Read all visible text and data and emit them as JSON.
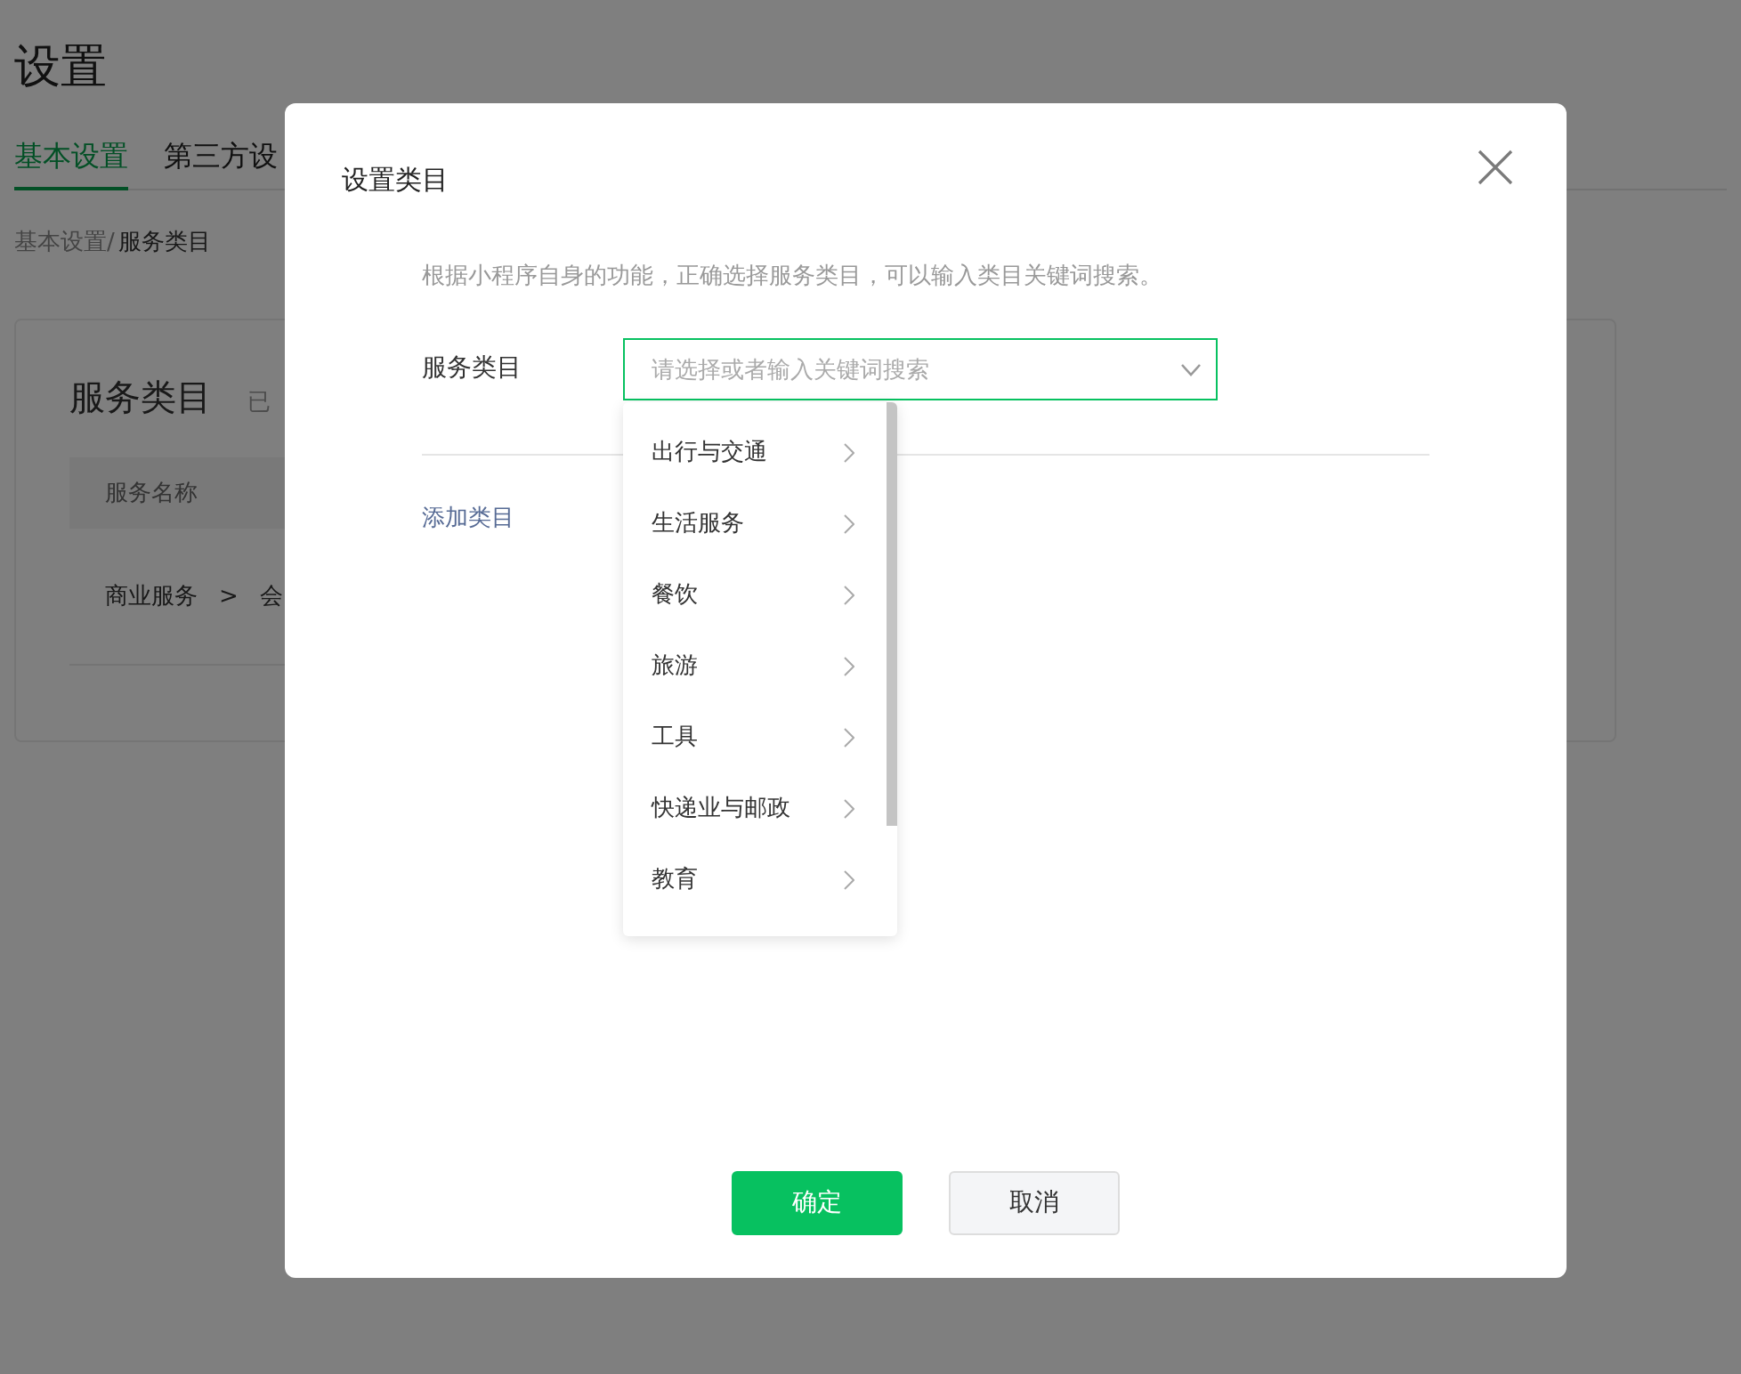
{
  "page": {
    "title": "设置",
    "tabs": [
      {
        "label": "基本设置",
        "selected": true
      },
      {
        "label": "第三方设",
        "selected": false
      }
    ],
    "breadcrumb": {
      "parent": "基本设置/",
      "current": "服务类目"
    },
    "card": {
      "title": "服务类目",
      "subtitle": "已",
      "table": {
        "columns": [
          "服务名称"
        ],
        "rows": [
          [
            "商业服务",
            ">",
            "会"
          ]
        ]
      }
    }
  },
  "dialog": {
    "title": "设置类目",
    "description": "根据小程序自身的功能，正确选择服务类目，可以输入类目关键词搜索。",
    "field_label": "服务类目",
    "select": {
      "placeholder": "请选择或者输入关键词搜索",
      "expanded": true,
      "options": [
        "出行与交通",
        "生活服务",
        "餐饮",
        "旅游",
        "工具",
        "快递业与邮政",
        "教育"
      ]
    },
    "add_link": "添加类目",
    "buttons": [
      {
        "label": "确定",
        "kind": "primary"
      },
      {
        "label": "取消",
        "kind": "default"
      }
    ]
  }
}
